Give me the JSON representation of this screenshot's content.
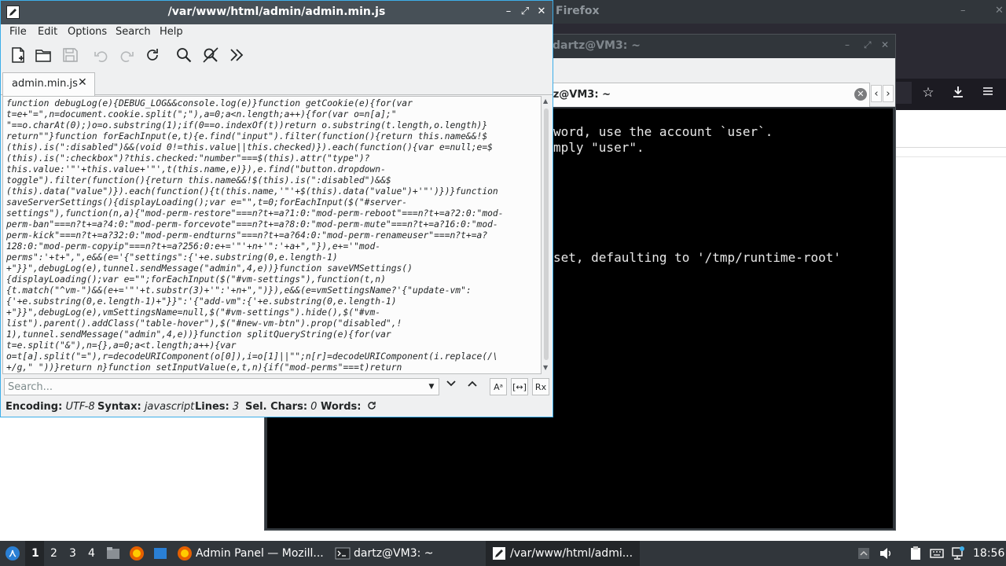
{
  "firefox": {
    "title": "Firefox",
    "controls": [
      "–",
      "✕"
    ]
  },
  "terminal": {
    "title": "dartz@VM3: ~",
    "tab_label": "dartz@VM3: ~",
    "tab_close": "✕",
    "nav_prev": "‹",
    "nav_next": "›",
    "lines": [
      "word, use the account `user`.",
      "mply \"user\".",
      "set, defaulting to '/tmp/runtime-root'"
    ]
  },
  "editor": {
    "title": "/var/www/html/admin/admin.min.js",
    "controls": {
      "minimize": "–",
      "maximize": "⤢",
      "close": "✕"
    },
    "menu": [
      "File",
      "Edit",
      "Options",
      "Search",
      "Help"
    ],
    "tab_label": "admin.min.js",
    "tab_close": "✕",
    "code_lines": [
      "function debugLog(e){DEBUG_LOG&&console.log(e)}function getCookie(e){for(var",
      "t=e+\"=\",n=document.cookie.split(\";\"),a=0;a<n.length;a++){for(var o=n[a];\"",
      "\"==o.charAt(0);)o=o.substring(1);if(0==o.indexOf(t))return o.substring(t.length,o.length)}",
      "return\"\"}function forEachInput(e,t){e.find(\"input\").filter(function(){return this.name&&!$",
      "(this).is(\":disabled\")&&(void 0!=this.value||this.checked)}).each(function(){var e=null;e=$",
      "(this).is(\":checkbox\")?this.checked:\"number\"===$(this).attr(\"type\")?",
      "this.value:'\"'+this.value+'\"',t(this.name,e)}),e.find(\"button.dropdown-",
      "toggle\").filter(function(){return this.name&&!$(this).is(\":disabled\")&&$",
      "(this).data(\"value\")}).each(function(){t(this.name,'\"'+$(this).data(\"value\")+'\"')})}function",
      "saveServerSettings(){displayLoading();var e=\"\",t=0;forEachInput($(\"#server-",
      "settings\"),function(n,a){\"mod-perm-restore\"===n?t+=a?1:0:\"mod-perm-reboot\"===n?t+=a?2:0:\"mod-",
      "perm-ban\"===n?t+=a?4:0:\"mod-perm-forcevote\"===n?t+=a?8:0:\"mod-perm-mute\"===n?t+=a?16:0:\"mod-",
      "perm-kick\"===n?t+=a?32:0:\"mod-perm-endturns\"===n?t+=a?64:0:\"mod-perm-renameuser\"===n?t+=a?",
      "128:0:\"mod-perm-copyip\"===n?t+=a?256:0:e+='\"'+n+'\":'+a+\",\"}),e+='\"mod-",
      "perms\":'+t+\",\",e&&(e='{\"settings\":{'+e.substring(0,e.length-1)",
      "+\"}}\",debugLog(e),tunnel.sendMessage(\"admin\",4,e))}function saveVMSettings()",
      "{displayLoading();var e=\"\";forEachInput($(\"#vm-settings\"),function(t,n)",
      "{t.match(\"^vm-\")&&(e+='\"'+t.substr(3)+'\":'+n+\",\")}),e&&(e=vmSettingsName?'{\"update-vm\":",
      "{'+e.substring(0,e.length-1)+\"}}\":'{\"add-vm\":{'+e.substring(0,e.length-1)",
      "+\"}}\",debugLog(e),vmSettingsName=null,$(\"#vm-settings\").hide(),$(\"#vm-",
      "list\").parent().addClass(\"table-hover\"),$(\"#new-vm-btn\").prop(\"disabled\",!",
      "1),tunnel.sendMessage(\"admin\",4,e))}function splitQueryString(e){for(var",
      "t=e.split(\"&\"),n={},a=0;a<t.length;a++){var",
      "o=t[a].split(\"=\"),r=decodeURIComponent(o[0]),i=o[1]||\"\";n[r]=decodeURIComponent(i.replace(/\\",
      "+/g,\" \"))}return n}function setInputValue(e,t,n){if(\"mod-perms\"===t)return"
    ],
    "search": {
      "placeholder": "Search...",
      "value": ""
    },
    "status": {
      "encoding_label": "Encoding:",
      "encoding_value": "UTF-8",
      "syntax_label": "Syntax:",
      "syntax_value": "javascript",
      "lines_label": "Lines:",
      "lines_value": "3",
      "selchars_label": "Sel. Chars:",
      "selchars_value": "0",
      "words_label": "Words:"
    }
  },
  "taskbar": {
    "workspaces": [
      "1",
      "2",
      "3",
      "4"
    ],
    "tasks": [
      {
        "label": "Admin Panel — Mozill...",
        "icon": "firefox-icon"
      },
      {
        "label": "dartz@VM3: ~",
        "icon": "terminal-icon"
      },
      {
        "label": "/var/www/html/admi...",
        "icon": "text-editor-icon"
      }
    ],
    "clock": "18:56"
  },
  "colors": {
    "editor_titlebar": "#475057",
    "focus_border": "#3daee9",
    "panel": "#31363b",
    "terminal_bg": "#000000"
  }
}
